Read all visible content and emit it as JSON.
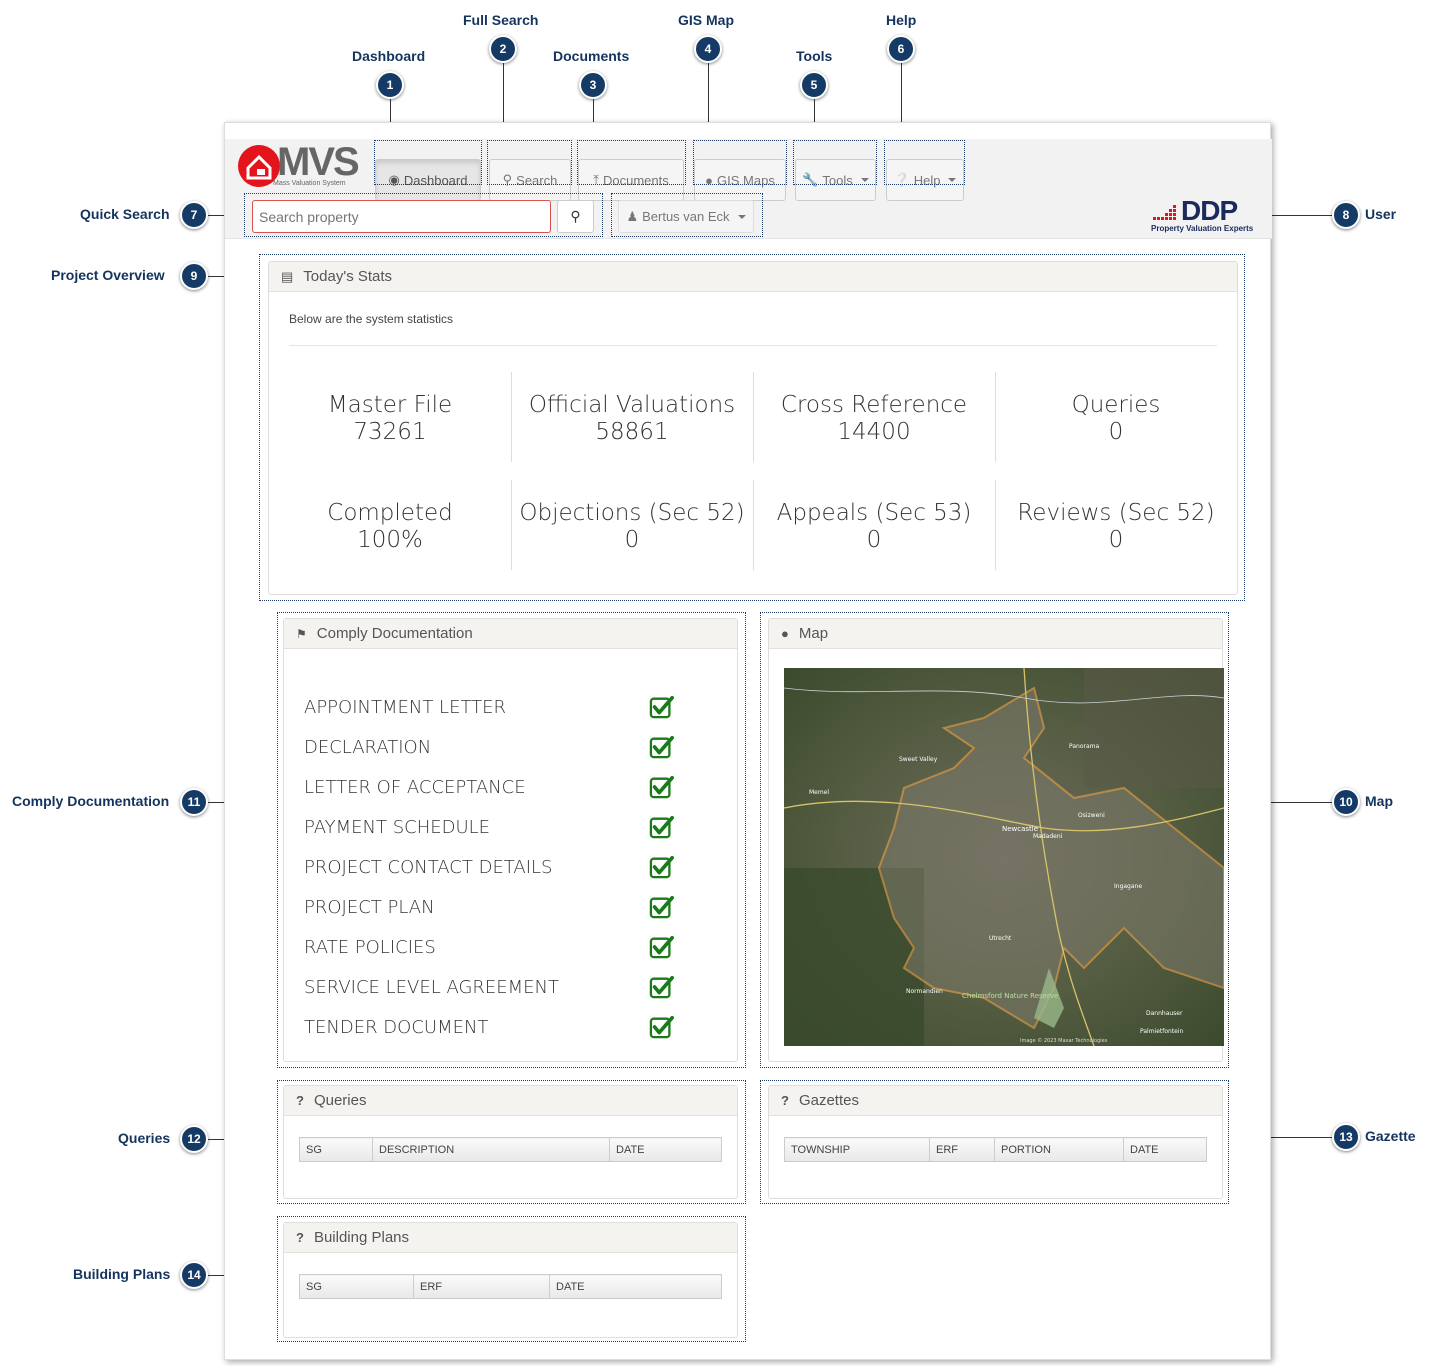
{
  "callouts": {
    "dashboard": {
      "num": "1",
      "label": "Dashboard"
    },
    "full_search": {
      "num": "2",
      "label": "Full Search"
    },
    "documents": {
      "num": "3",
      "label": "Documents"
    },
    "gis_map": {
      "num": "4",
      "label": "GIS Map"
    },
    "tools": {
      "num": "5",
      "label": "Tools"
    },
    "help": {
      "num": "6",
      "label": "Help"
    },
    "quick_search": {
      "num": "7",
      "label": "Quick Search"
    },
    "user": {
      "num": "8",
      "label": "User"
    },
    "project_overview": {
      "num": "9",
      "label": "Project Overview"
    },
    "map": {
      "num": "10",
      "label": "Map"
    },
    "comply_documentation": {
      "num": "11",
      "label": "Comply Documentation"
    },
    "queries": {
      "num": "12",
      "label": "Queries"
    },
    "gazette": {
      "num": "13",
      "label": "Gazette"
    },
    "building_plans": {
      "num": "14",
      "label": "Building Plans"
    }
  },
  "brand": {
    "logo_text": "MVS",
    "logo_sub": "Mass Valuation System",
    "partner": "DDP",
    "partner_sub": "Property Valuation Experts",
    "red": "#e3141b",
    "navy": "#1a2a5c"
  },
  "nav": {
    "dashboard": "Dashboard",
    "search": "Search",
    "documents": "Documents",
    "gis_maps": "GIS Maps",
    "tools": "Tools",
    "help": "Help"
  },
  "search": {
    "placeholder": "Search property"
  },
  "user": {
    "name": "Bertus van Eck"
  },
  "stats": {
    "title": "Today's Stats",
    "intro": "Below are the system statistics",
    "items": [
      {
        "label": "Master File",
        "value": "73261"
      },
      {
        "label": "Official Valuations",
        "value": "58861"
      },
      {
        "label": "Cross Reference",
        "value": "14400"
      },
      {
        "label": "Queries",
        "value": "0"
      },
      {
        "label": "Completed",
        "value": "100%"
      },
      {
        "label": "Objections (Sec 52)",
        "value": "0"
      },
      {
        "label": "Appeals (Sec 53)",
        "value": "0"
      },
      {
        "label": "Reviews (Sec 52)",
        "value": "0"
      }
    ]
  },
  "comply": {
    "title": "Comply Documentation",
    "items": [
      "APPOINTMENT LETTER",
      "DECLARATION",
      "LETTER OF ACCEPTANCE",
      "PAYMENT SCHEDULE",
      "PROJECT CONTACT DETAILS",
      "PROJECT PLAN",
      "RATE POLICIES",
      "SERVICE LEVEL AGREEMENT",
      "TENDER DOCUMENT"
    ]
  },
  "map": {
    "title": "Map",
    "labels": {
      "newcastle": "Newcastle",
      "madadeni": "Madadeni",
      "osizweni": "Osizweni",
      "ingagane": "Ingagane",
      "normandien": "Normandien",
      "chelmsford": "Chelmsford Nature Reserve",
      "dannhauser": "Dannhauser",
      "palmietfontein": "Palmietfontein",
      "memel": "Memel",
      "sweet_valley": "Sweet Valley",
      "panorama": "Panorama",
      "utrecht": "Utrecht"
    },
    "attribution": "Image © 2023 Maxar Technologies"
  },
  "queries": {
    "title": "Queries",
    "columns": [
      "SG",
      "DESCRIPTION",
      "DATE"
    ]
  },
  "gazettes": {
    "title": "Gazettes",
    "columns": [
      "TOWNSHIP",
      "ERF",
      "PORTION",
      "DATE"
    ]
  },
  "building_plans": {
    "title": "Building Plans",
    "columns": [
      "SG",
      "ERF",
      "DATE"
    ]
  }
}
